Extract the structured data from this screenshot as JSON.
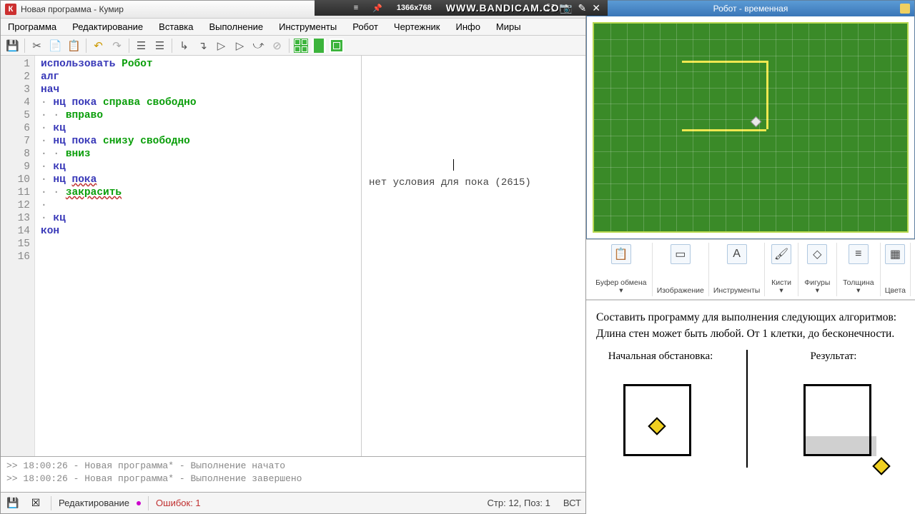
{
  "bandicam": {
    "resolution": "1366x768",
    "logo": "WWW.BANDICAM.COM"
  },
  "kumir": {
    "title": "Новая программа - Кумир",
    "menu": [
      "Программа",
      "Редактирование",
      "Вставка",
      "Выполнение",
      "Инструменты",
      "Робот",
      "Чертежник",
      "Инфо",
      "Миры"
    ],
    "code_lines": [
      {
        "n": 1,
        "parts": [
          {
            "t": "использовать ",
            "c": "kw-blue"
          },
          {
            "t": "Робот",
            "c": "kw-green"
          }
        ]
      },
      {
        "n": 2,
        "parts": [
          {
            "t": "алг",
            "c": "kw-blue"
          }
        ]
      },
      {
        "n": 3,
        "parts": [
          {
            "t": "нач",
            "c": "kw-blue"
          }
        ]
      },
      {
        "n": 4,
        "parts": [
          {
            "t": "· ",
            "c": "bullet"
          },
          {
            "t": "нц пока ",
            "c": "kw-blue"
          },
          {
            "t": "справа свободно",
            "c": "kw-green"
          }
        ]
      },
      {
        "n": 5,
        "parts": [
          {
            "t": "· · ",
            "c": "bullet"
          },
          {
            "t": "вправо",
            "c": "kw-green"
          }
        ]
      },
      {
        "n": 6,
        "parts": [
          {
            "t": "· ",
            "c": "bullet"
          },
          {
            "t": "кц",
            "c": "kw-blue"
          }
        ]
      },
      {
        "n": 7,
        "parts": [
          {
            "t": "· ",
            "c": "bullet"
          },
          {
            "t": "нц пока ",
            "c": "kw-blue"
          },
          {
            "t": "снизу свободно",
            "c": "kw-green"
          }
        ]
      },
      {
        "n": 8,
        "parts": [
          {
            "t": "· · ",
            "c": "bullet"
          },
          {
            "t": "вниз",
            "c": "kw-green"
          }
        ]
      },
      {
        "n": 9,
        "parts": [
          {
            "t": "· ",
            "c": "bullet"
          },
          {
            "t": "кц",
            "c": "kw-blue"
          }
        ]
      },
      {
        "n": 10,
        "parts": [
          {
            "t": "· ",
            "c": "bullet"
          },
          {
            "t": "нц ",
            "c": "kw-blue"
          },
          {
            "t": "пока",
            "c": "kw-blue err"
          }
        ]
      },
      {
        "n": 11,
        "parts": [
          {
            "t": "· · ",
            "c": "bullet"
          },
          {
            "t": "закрасить",
            "c": "kw-green err"
          }
        ]
      },
      {
        "n": 12,
        "parts": [
          {
            "t": "· ",
            "c": "bullet"
          }
        ]
      },
      {
        "n": 13,
        "parts": [
          {
            "t": "· ",
            "c": "bullet"
          },
          {
            "t": "кц",
            "c": "kw-blue"
          }
        ]
      },
      {
        "n": 14,
        "parts": [
          {
            "t": "кон",
            "c": "kw-blue"
          }
        ]
      },
      {
        "n": 15,
        "parts": []
      },
      {
        "n": 16,
        "parts": []
      }
    ],
    "output_msg": "нет условия для пока  (2615)",
    "console": [
      ">> 18:00:26 - Новая программа* - Выполнение начато",
      ">> 18:00:26 - Новая программа* - Выполнение завершено"
    ],
    "status": {
      "mode": "Редактирование",
      "errors": "Ошибок: 1",
      "pos": "Стр: 12, Поз: 1",
      "ovr": "ВСТ"
    }
  },
  "robot_win": {
    "title": "Робот - временная"
  },
  "paint": {
    "groups": [
      {
        "label": "Буфер\nобмена ▾",
        "icon": "📋"
      },
      {
        "label": "Изображение",
        "icon": "▭"
      },
      {
        "label": "Инструменты",
        "icon": "A"
      },
      {
        "label": "Кисти\n▾",
        "icon": "🖌"
      },
      {
        "label": "Фигуры\n▾",
        "icon": "◇"
      },
      {
        "label": "Толщина\n▾",
        "icon": "≡"
      },
      {
        "label": "Цвета",
        "icon": "▦"
      }
    ]
  },
  "task": {
    "line1": "Составить программу для выполнения следующих алгоритмов:",
    "line2": "Длина стен может быть любой. От 1 клетки, до бесконечности.",
    "fig1_label": "Начальная обстановка:",
    "fig2_label": "Результат:"
  }
}
